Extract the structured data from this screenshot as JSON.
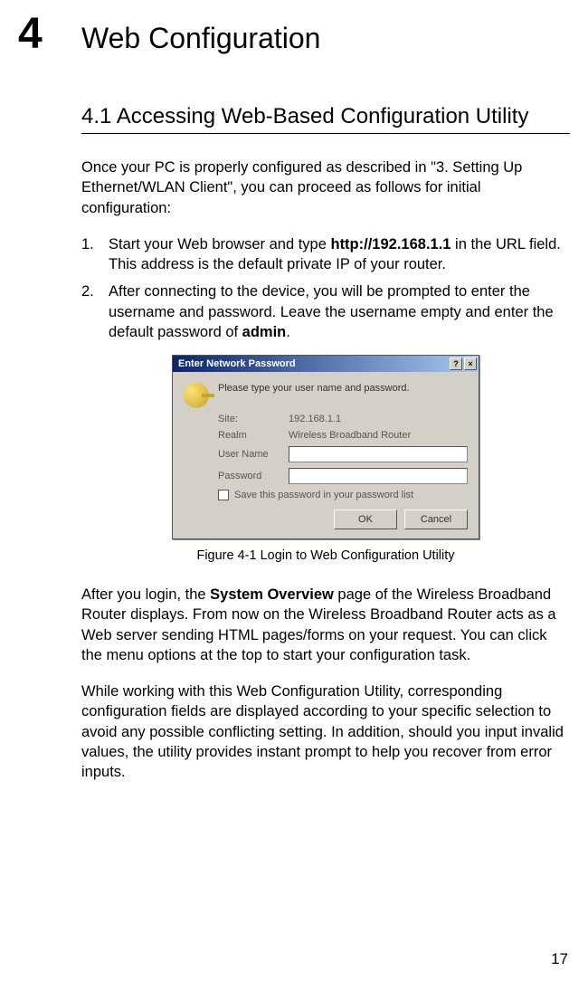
{
  "chapter": {
    "number": "4",
    "title": "Web Configuration"
  },
  "section": {
    "title": "4.1 Accessing Web-Based Configuration Utility"
  },
  "intro": "Once your PC is properly configured as described in \"3. Setting Up Ethernet/WLAN Client\", you can proceed as follows for initial configuration:",
  "steps": {
    "1": {
      "num": "1.",
      "pre": "Start your Web browser and type ",
      "mid_bold": "http://192.168.1.1",
      "post": " in the URL field. This address is the default private IP of your router."
    },
    "2": {
      "num": "2.",
      "pre": "After connecting to the device, you will be prompted to enter the username and password. Leave the username empty and enter the default password of ",
      "mid_bold": "admin",
      "post": "."
    }
  },
  "dialog": {
    "title": "Enter Network Password",
    "help_btn": "?",
    "close_btn": "×",
    "prompt": "Please type your user name and password.",
    "rows": {
      "site_label": "Site:",
      "site_value": "192.168.1.1",
      "realm_label": "Realm",
      "realm_value": "Wireless Broadband Router",
      "user_label": "User Name",
      "pass_label": "Password"
    },
    "checkbox_label": "Save this password in your password list",
    "ok": "OK",
    "cancel": "Cancel"
  },
  "figure_caption": "Figure 4-1    Login to Web Configuration Utility",
  "after_1": {
    "pre": "After you login, the ",
    "bold": "System Overview",
    "post": " page of the Wireless Broadband Router displays. From now on the Wireless Broadband Router acts as a Web server sending HTML pages/forms on your request. You can click the menu options at the top to start your configuration task."
  },
  "after_2": "While working with this Web Configuration Utility, corresponding configuration fields are displayed according to your specific selection to avoid any possible conflicting setting. In addition, should you input invalid values, the utility provides instant prompt to help you recover from error inputs.",
  "page_number": "17"
}
